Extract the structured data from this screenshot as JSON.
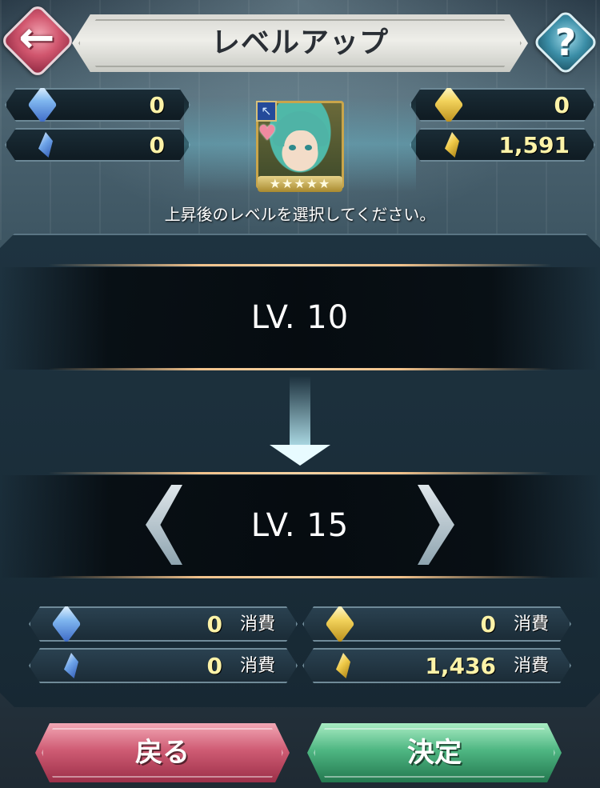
{
  "header": {
    "title": "レベルアップ",
    "back_icon": "←",
    "help_label": "?"
  },
  "resources": {
    "great_badges_blue": "0",
    "badges_blue": "0",
    "great_badges_gold": "0",
    "badges_gold": "1,591"
  },
  "hero": {
    "rarity_stars": "★★★★★",
    "weapon_icon": "↖",
    "heart_icon": "♥"
  },
  "instruction": "上昇後のレベルを選択してください。",
  "level": {
    "current": "LV. 10",
    "target": "LV. 15"
  },
  "costs": {
    "great_blue": "0",
    "blue": "0",
    "great_gold": "0",
    "gold": "1,436",
    "label": "消費"
  },
  "buttons": {
    "back": "戻る",
    "confirm": "決定"
  },
  "colors": {
    "value_text": "#fdf3a8",
    "back_button": "#cf5c74",
    "confirm_button": "#4fb783",
    "gold_line": "#f1c28c"
  }
}
